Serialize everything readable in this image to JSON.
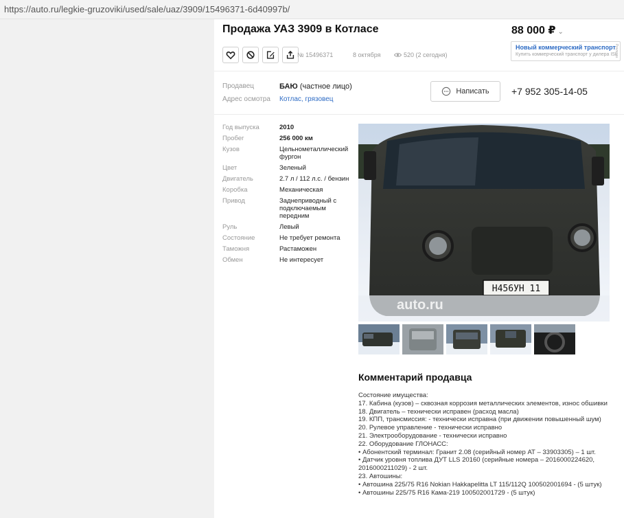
{
  "browser": {
    "url": "https://auto.ru/legkie-gruzoviki/used/sale/uaz/3909/15496371-6d40997b/"
  },
  "listing": {
    "title": "Продажа УАЗ 3909 в Котласе",
    "price": "88 000 ₽",
    "price_chevron": "⌄",
    "id_text": "№ 15496371",
    "date": "8 октября",
    "views": "520 (2 сегодня)"
  },
  "actions": {
    "favorite_icon": "heart-icon",
    "block_icon": "forbidden-icon",
    "compare_icon": "edit-icon",
    "share_icon": "share-icon"
  },
  "promo": {
    "title": "Новый коммерческий транспорт",
    "subtitle": "Купить коммерческий транспорт у дилера ISL",
    "ad_label": "Реклама"
  },
  "seller": {
    "seller_label": "Продавец",
    "name": "БАЮ",
    "name_suffix": " (частное лицо)",
    "address_label": "Адрес осмотра",
    "address": "Котлас, грязовец",
    "write_button": "Написать",
    "phone": "+7 952 305-14-05"
  },
  "specs": [
    {
      "key": "Год выпуска",
      "value": "2010",
      "bold": true
    },
    {
      "key": "Пробег",
      "value": "256 000 км",
      "bold": true
    },
    {
      "key": "Кузов",
      "value": "Цельнометаллический фургон",
      "bold": false
    },
    {
      "key": "Цвет",
      "value": "Зеленый",
      "bold": false
    },
    {
      "key": "Двигатель",
      "value": "2.7 л / 112 л.с. / бензин",
      "bold": false
    },
    {
      "key": "Коробка",
      "value": "Механическая",
      "bold": false
    },
    {
      "key": "Привод",
      "value": "Заднеприводный с подключаемым передним",
      "bold": false
    },
    {
      "key": "Руль",
      "value": "Левый",
      "bold": false
    },
    {
      "key": "Состояние",
      "value": "Не требует ремонта",
      "bold": false
    },
    {
      "key": "Таможня",
      "value": "Растаможен",
      "bold": false
    },
    {
      "key": "Обмен",
      "value": "Не интересует",
      "bold": false
    }
  ],
  "gallery": {
    "plate": "Н456УН 11",
    "watermark": "auto.ru"
  },
  "comment": {
    "title": "Комментарий продавца",
    "lines": [
      "Состояние имущества:",
      "17. Кабина (кузов) – сквозная коррозия металлических элементов, износ обшивки",
      "18. Двигатель – технически исправен (расход масла)",
      "19. КПП, трансмиссия: - технически исправна (при движении повышенный шум)",
      "20. Рулевое управление - технически исправно",
      "21. Электрооборудование - технически исправно",
      "22. Оборудование ГЛОНАСС:",
      "• Абонентский терминал: Гранит 2.08 (серийный номер АТ – 33903305) – 1 шт.",
      "• Датчик уровня топлива ДУТ LLS 20160 (серийные номера – 2016000224620,",
      "2016000211029) - 2 шт.",
      "23. Автошины:",
      "• Автошина 225/75 R16 Nokian Hakkapelitta LT 115/112Q 100502001694 - (5 штук)",
      "• Автошины 225/75 R16 Кама-219 100502001729 - (5 штук)"
    ]
  }
}
